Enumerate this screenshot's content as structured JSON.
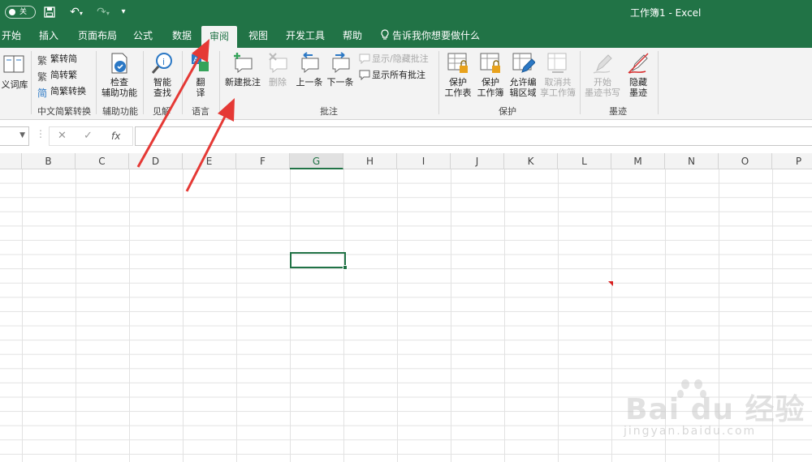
{
  "title_bar": {
    "autosave_label": "关",
    "document_title": "工作簿1  -  Excel"
  },
  "tabs": [
    {
      "label": "开始"
    },
    {
      "label": "插入"
    },
    {
      "label": "页面布局"
    },
    {
      "label": "公式"
    },
    {
      "label": "数据"
    },
    {
      "label": "审阅",
      "active": true
    },
    {
      "label": "视图"
    },
    {
      "label": "开发工具"
    },
    {
      "label": "帮助"
    }
  ],
  "tell_me": "告诉我你想要做什么",
  "ribbon": {
    "thesaurus_label": "义词库",
    "chinese_convert": {
      "to_traditional": "繁转简",
      "to_simplified": "简转繁",
      "convert": "简繁转换",
      "group": "中文简繁转换"
    },
    "accessibility": {
      "check_line1": "检查",
      "check_line2": "辅助功能",
      "group": "辅助功能"
    },
    "insights": {
      "smart_line1": "智能",
      "smart_line2": "查找",
      "group": "见解"
    },
    "language": {
      "translate_line1": "翻",
      "translate_line2": "译",
      "group": "语言"
    },
    "comments": {
      "new": "新建批注",
      "delete": "删除",
      "previous": "上一条",
      "next": "下一条",
      "show_hide": "显示/隐藏批注",
      "show_all": "显示所有批注",
      "group": "批注"
    },
    "protect": {
      "sheet_line1": "保护",
      "sheet_line2": "工作表",
      "workbook_line1": "保护",
      "workbook_line2": "工作簿",
      "allow_line1": "允许编",
      "allow_line2": "辑区域",
      "unshare_line1": "取消共",
      "unshare_line2": "享工作簿",
      "group": "保护"
    },
    "ink": {
      "start_line1": "开始",
      "start_line2": "墨迹书写",
      "hide_line1": "隐藏",
      "hide_line2": "墨迹",
      "group": "墨迹"
    }
  },
  "formula_bar": {
    "fx": "fx"
  },
  "columns": [
    "B",
    "C",
    "D",
    "E",
    "F",
    "G",
    "H",
    "I",
    "J",
    "K",
    "L",
    "M",
    "N",
    "O",
    "P"
  ],
  "selected_column": "G",
  "watermark": {
    "brand": "Bai  du 经验",
    "url": "jingyan.baidu.com"
  },
  "colors": {
    "excel_green": "#217346",
    "arrow_red": "#e53935"
  }
}
